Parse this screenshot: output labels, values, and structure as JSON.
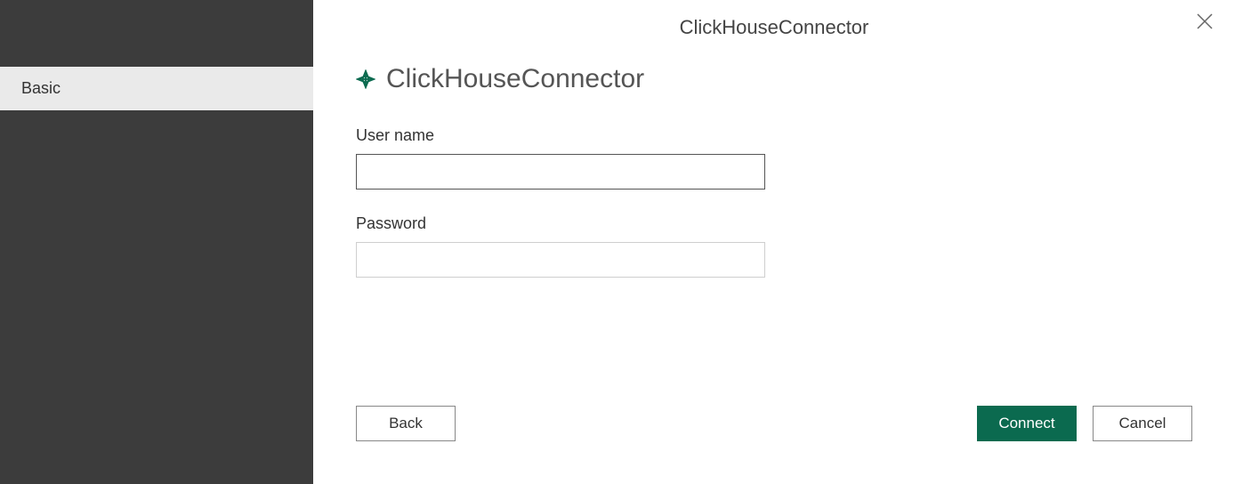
{
  "window": {
    "title": "ClickHouseConnector"
  },
  "sidebar": {
    "items": [
      {
        "label": "Basic"
      }
    ]
  },
  "page": {
    "title": "ClickHouseConnector"
  },
  "fields": {
    "username": {
      "label": "User name",
      "value": ""
    },
    "password": {
      "label": "Password",
      "value": ""
    }
  },
  "buttons": {
    "back": "Back",
    "connect": "Connect",
    "cancel": "Cancel"
  }
}
